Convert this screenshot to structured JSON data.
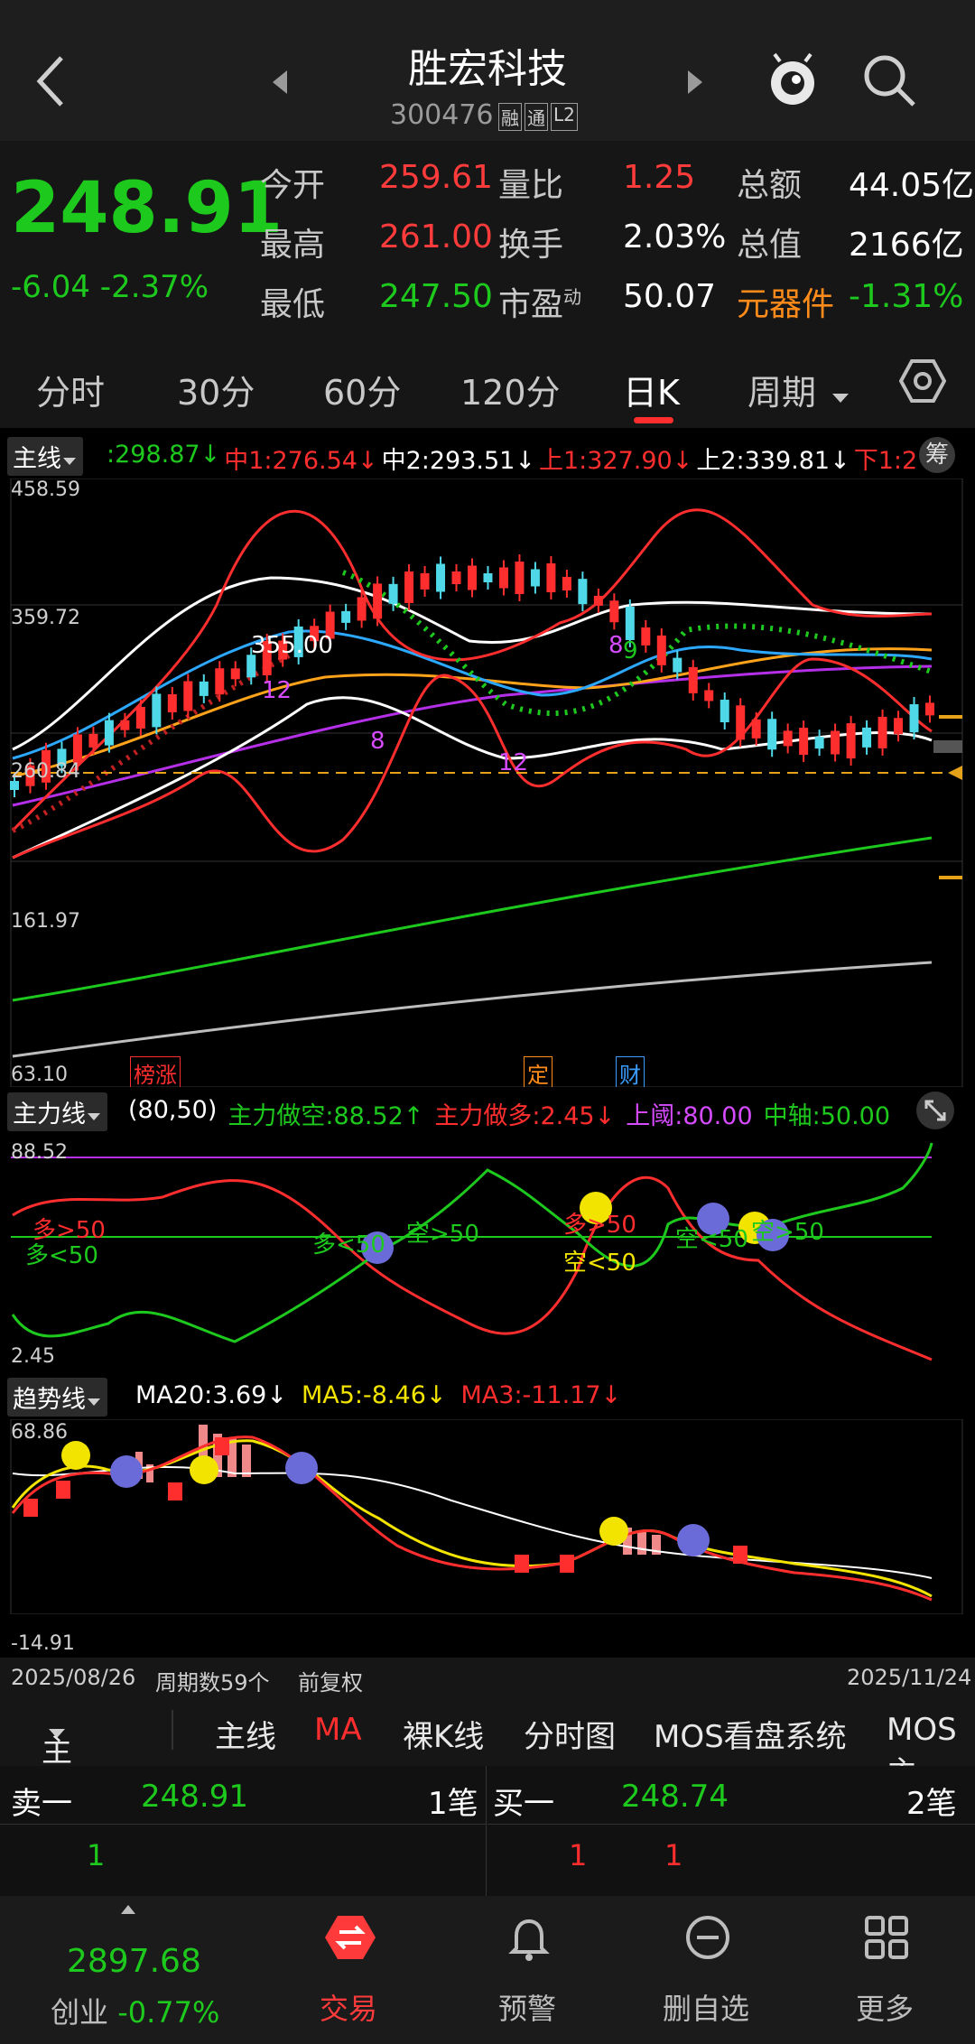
{
  "header": {
    "title": "胜宏科技",
    "code": "300476",
    "badges": [
      "融",
      "通",
      "L2"
    ]
  },
  "quote": {
    "price": "248.91",
    "change": "-6.04",
    "change_pct": "-2.37%",
    "rows": [
      [
        {
          "label": "今开",
          "value": "259.61",
          "color": "#ff3b3b"
        },
        {
          "label": "量比",
          "value": "1.25",
          "color": "#ff3b3b"
        },
        {
          "label": "总额",
          "value": "44.05亿",
          "color": "#ffffff"
        }
      ],
      [
        {
          "label": "最高",
          "value": "261.00",
          "color": "#ff3b3b"
        },
        {
          "label": "换手",
          "value": "2.03%",
          "color": "#ffffff"
        },
        {
          "label": "总值",
          "value": "2166亿",
          "color": "#ffffff"
        }
      ],
      [
        {
          "label": "最低",
          "value": "247.50",
          "color": "#1ec91e"
        },
        {
          "label": "市盈",
          "label_sup": "动",
          "value": "50.07",
          "color": "#ffffff"
        },
        {
          "label": "元器件",
          "value": "-1.31%",
          "color": "#1ec91e"
        }
      ]
    ]
  },
  "tabs": [
    "分时",
    "30分",
    "60分",
    "120分",
    "日K",
    "周期"
  ],
  "active_tab": "日K",
  "main_chart": {
    "label": "主线",
    "indicators": [
      {
        "text": ":298.87↓",
        "color": "#1ec91e"
      },
      {
        "text": "中1:276.54↓",
        "color": "#ff2e2e"
      },
      {
        "text": "中2:293.51↓",
        "color": "#ffffff"
      },
      {
        "text": "上1:327.90↓",
        "color": "#ff2e2e"
      },
      {
        "text": "上2:339.81↓",
        "color": "#ffffff"
      },
      {
        "text": "下1:2",
        "color": "#ff2e2e"
      }
    ],
    "chip_button": "筹",
    "y_labels": [
      "458.59",
      "359.72",
      "260.84",
      "161.97",
      "63.10"
    ],
    "annotations": [
      "355.00",
      "12",
      "8",
      "12",
      "8",
      "9"
    ],
    "event_tags": [
      "榜涨",
      "定",
      "财"
    ]
  },
  "main_force": {
    "label": "主力线",
    "params": "(80,50)",
    "values": [
      {
        "text": "主力做空:88.52↑",
        "color": "#1ec91e"
      },
      {
        "text": "主力做多:2.45↓",
        "color": "#ff2e2e"
      },
      {
        "text": "上阈:80.00",
        "color": "#d64bff"
      },
      {
        "text": "中轴:50.00",
        "color": "#1ec91e"
      }
    ],
    "y_top": "88.52",
    "y_bottom": "2.45",
    "marks": [
      "多>50",
      "多<50",
      "多<50",
      "空>50",
      "多>50",
      "空<50",
      "空<50",
      "空>50"
    ]
  },
  "trend": {
    "label": "趋势线",
    "values": [
      {
        "text": "MA20:3.69↓",
        "color": "#ffffff"
      },
      {
        "text": "MA5:-8.46↓",
        "color": "#f3e400"
      },
      {
        "text": "MA3:-11.17↓",
        "color": "#ff2e2e"
      }
    ],
    "y_top": "68.86",
    "y_bottom": "-14.91"
  },
  "footer_info": {
    "start_date": "2025/08/26",
    "period_count": "周期数59个",
    "adjust": "前复权",
    "end_date": "2025/11/24"
  },
  "menu": {
    "dropdown": "主图",
    "items": [
      "主线",
      "MA",
      "裸K线",
      "分时图",
      "MOS看盘系统",
      "MOS主"
    ]
  },
  "orderbook": {
    "sell_label": "卖一",
    "sell_price": "248.91",
    "sell_count": "1笔",
    "buy_label": "买一",
    "buy_price": "248.74",
    "buy_count": "2笔",
    "sell_sub": [
      "1"
    ],
    "buy_sub": [
      "1",
      "1"
    ]
  },
  "bottom_nav": {
    "index_value": "2897.68",
    "index_name": "创业",
    "index_change": "-0.77%",
    "items": [
      "交易",
      "预警",
      "删自选",
      "更多"
    ]
  }
}
